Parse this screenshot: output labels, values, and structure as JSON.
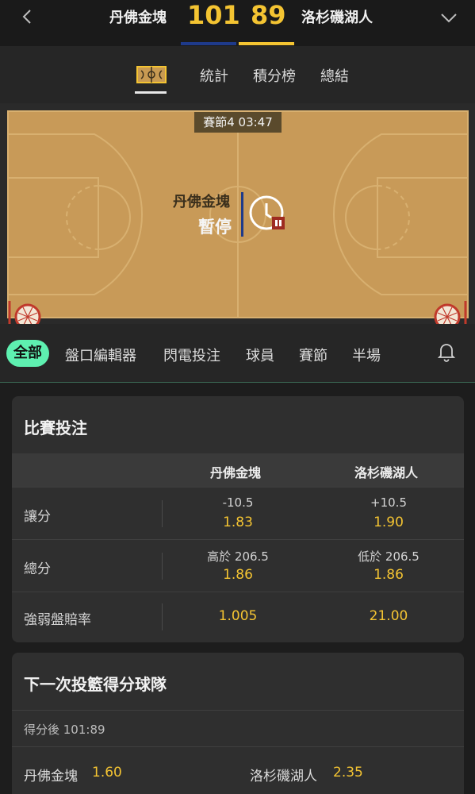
{
  "header": {
    "home_team": "丹佛金塊",
    "home_score": "101",
    "away_score": "89",
    "away_team": "洛杉磯湖人"
  },
  "tabs": {
    "items": [
      "統計",
      "積分榜",
      "總結"
    ],
    "active_icon": "basketball-court-icon"
  },
  "court": {
    "period_clock": "賽節4  03:47",
    "team": "丹佛金塊",
    "status": "暫停"
  },
  "filters": {
    "items": [
      "全部",
      "盤口編輯器",
      "閃電投注",
      "球員",
      "賽節",
      "半場"
    ]
  },
  "match_bets": {
    "title": "比賽投注",
    "columns": [
      "丹佛金塊",
      "洛杉磯湖人"
    ],
    "rows": [
      {
        "label": "讓分",
        "home_line": "-10.5",
        "home_odds": "1.83",
        "away_line": "+10.5",
        "away_odds": "1.90"
      },
      {
        "label": "總分",
        "home_line": "高於 206.5",
        "home_odds": "1.86",
        "away_line": "低於 206.5",
        "away_odds": "1.86"
      },
      {
        "label": "強弱盤賠率",
        "home_line": "",
        "home_odds": "1.005",
        "away_line": "",
        "away_odds": "21.00"
      }
    ]
  },
  "next_score": {
    "title": "下一次投籃得分球隊",
    "subtitle": "得分後 101:89",
    "home_name": "丹佛金塊",
    "home_odds": "1.60",
    "away_name": "洛杉磯湖人",
    "away_odds": "2.35"
  },
  "colors": {
    "accent": "#f4c432",
    "filter_active": "#5ef0b0",
    "home_bar": "#1e3a8a"
  }
}
